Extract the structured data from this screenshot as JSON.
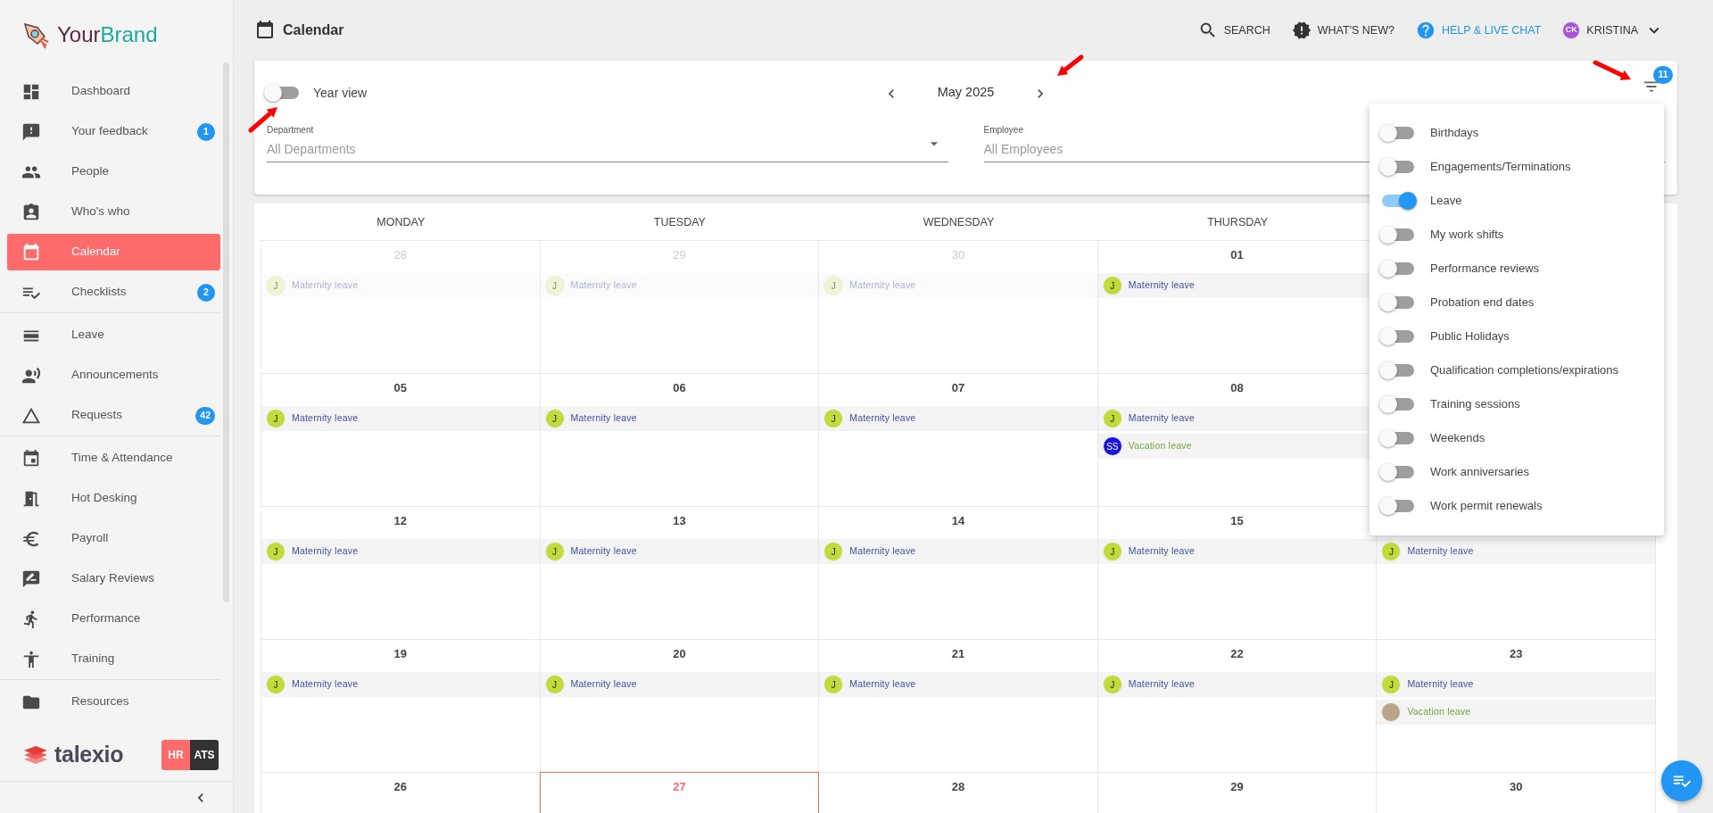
{
  "sidebar": {
    "brand_name": [
      "Your",
      "Brand"
    ],
    "groups": [
      [
        {
          "label": "Dashboard",
          "selected": false
        },
        {
          "label": "Your feedback",
          "badge": "1",
          "selected": false
        },
        {
          "label": "People",
          "selected": false
        },
        {
          "label": "Who's who",
          "selected": false
        },
        {
          "label": "Calendar",
          "selected": true
        },
        {
          "label": "Checklists",
          "badge": "2",
          "selected": false
        }
      ],
      [
        {
          "label": "Leave",
          "selected": false
        },
        {
          "label": "Announcements",
          "selected": false
        },
        {
          "label": "Requests",
          "badge": "42",
          "selected": false
        }
      ],
      [
        {
          "label": "Time & Attendance",
          "selected": false
        },
        {
          "label": "Hot Desking",
          "selected": false
        },
        {
          "label": "Payroll",
          "selected": false
        },
        {
          "label": "Salary Reviews",
          "selected": false
        },
        {
          "label": "Performance",
          "selected": false
        },
        {
          "label": "Training",
          "selected": false
        }
      ],
      [
        {
          "label": "Resources",
          "selected": false
        }
      ]
    ],
    "footer": {
      "logo_text": "talexio",
      "modes": [
        {
          "label": "HR",
          "selected": true
        },
        {
          "label": "ATS",
          "selected": false
        }
      ]
    }
  },
  "header": {
    "title": "Calendar",
    "actions": [
      {
        "label": "SEARCH",
        "kind": "search"
      },
      {
        "label": "WHAT'S NEW?",
        "kind": "news"
      },
      {
        "label": "HELP & LIVE CHAT",
        "kind": "help"
      }
    ],
    "user": {
      "initials": "CK",
      "name": "KRISTINA"
    }
  },
  "filters": {
    "year_view": {
      "label": "Year view",
      "on": false
    },
    "period": "May 2025",
    "fields": [
      {
        "label": "Department",
        "placeholder": "All Departments"
      },
      {
        "label": "Employee",
        "placeholder": "All Employees"
      }
    ],
    "filter_count": "11",
    "menu": [
      {
        "label": "Birthdays",
        "on": false
      },
      {
        "label": "Engagements/Terminations",
        "on": false
      },
      {
        "label": "Leave",
        "on": true
      },
      {
        "label": "My work shifts",
        "on": false
      },
      {
        "label": "Performance reviews",
        "on": false
      },
      {
        "label": "Probation end dates",
        "on": false
      },
      {
        "label": "Public Holidays",
        "on": false
      },
      {
        "label": "Qualification completions/expirations",
        "on": false
      },
      {
        "label": "Training sessions",
        "on": false
      },
      {
        "label": "Weekends",
        "on": false
      },
      {
        "label": "Work anniversaries",
        "on": false
      },
      {
        "label": "Work permit renewals",
        "on": false
      }
    ]
  },
  "calendar": {
    "weekdays": [
      "MONDAY",
      "TUESDAY",
      "WEDNESDAY",
      "THURSDAY"
    ],
    "weeks": [
      [
        {
          "date": "28",
          "outside": true,
          "today": false,
          "events": [
            {
              "kind": "maternity",
              "label": "Maternity leave",
              "avatar": {
                "kind": "initials",
                "text": "J",
                "color": "#eef5d2"
              }
            }
          ]
        },
        {
          "date": "29",
          "outside": true,
          "today": false,
          "events": [
            {
              "kind": "maternity",
              "label": "Maternity leave",
              "avatar": {
                "kind": "initials",
                "text": "J",
                "color": "#eef5d2"
              }
            }
          ]
        },
        {
          "date": "30",
          "outside": true,
          "today": false,
          "events": [
            {
              "kind": "maternity",
              "label": "Maternity leave",
              "avatar": {
                "kind": "initials",
                "text": "J",
                "color": "#eef5d2"
              }
            }
          ]
        },
        {
          "date": "01",
          "outside": false,
          "today": false,
          "events": [
            {
              "kind": "maternity",
              "label": "Maternity leave",
              "avatar": {
                "kind": "initials",
                "text": "J",
                "color": "#c0dc3b"
              }
            }
          ]
        }
      ],
      [
        {
          "date": "05",
          "outside": false,
          "today": false,
          "events": [
            {
              "kind": "maternity",
              "label": "Maternity leave",
              "avatar": {
                "kind": "initials",
                "text": "J",
                "color": "#c0dc3b"
              }
            }
          ]
        },
        {
          "date": "06",
          "outside": false,
          "today": false,
          "events": [
            {
              "kind": "maternity",
              "label": "Maternity leave",
              "avatar": {
                "kind": "initials",
                "text": "J",
                "color": "#c0dc3b"
              }
            }
          ]
        },
        {
          "date": "07",
          "outside": false,
          "today": false,
          "events": [
            {
              "kind": "maternity",
              "label": "Maternity leave",
              "avatar": {
                "kind": "initials",
                "text": "J",
                "color": "#c0dc3b"
              }
            }
          ]
        },
        {
          "date": "08",
          "outside": false,
          "today": false,
          "events": [
            {
              "kind": "maternity",
              "label": "Maternity leave",
              "avatar": {
                "kind": "initials",
                "text": "J",
                "color": "#c0dc3b"
              }
            },
            {
              "kind": "vacation",
              "label": "Vacation leave",
              "avatar": {
                "kind": "initials",
                "text": "SS",
                "color": "#1a10e0"
              }
            }
          ]
        }
      ],
      [
        {
          "date": "12",
          "outside": false,
          "today": false,
          "events": [
            {
              "kind": "maternity",
              "label": "Maternity leave",
              "avatar": {
                "kind": "initials",
                "text": "J",
                "color": "#c0dc3b"
              }
            }
          ]
        },
        {
          "date": "13",
          "outside": false,
          "today": false,
          "events": [
            {
              "kind": "maternity",
              "label": "Maternity leave",
              "avatar": {
                "kind": "initials",
                "text": "J",
                "color": "#c0dc3b"
              }
            }
          ]
        },
        {
          "date": "14",
          "outside": false,
          "today": false,
          "events": [
            {
              "kind": "maternity",
              "label": "Maternity leave",
              "avatar": {
                "kind": "initials",
                "text": "J",
                "color": "#c0dc3b"
              }
            }
          ]
        },
        {
          "date": "15",
          "outside": false,
          "today": false,
          "events": [
            {
              "kind": "maternity",
              "label": "Maternity leave",
              "avatar": {
                "kind": "initials",
                "text": "J",
                "color": "#c0dc3b"
              }
            }
          ]
        },
        {
          "outside": false,
          "today": false,
          "events": [
            {
              "kind": "maternity",
              "label": "Maternity leave",
              "avatar": {
                "kind": "initials",
                "text": "J",
                "color": "#c0dc3b"
              }
            }
          ]
        }
      ],
      [
        {
          "date": "19",
          "outside": false,
          "today": false,
          "events": [
            {
              "kind": "maternity",
              "label": "Maternity leave",
              "avatar": {
                "kind": "initials",
                "text": "J",
                "color": "#c0dc3b"
              }
            }
          ]
        },
        {
          "date": "20",
          "outside": false,
          "today": false,
          "events": [
            {
              "kind": "maternity",
              "label": "Maternity leave",
              "avatar": {
                "kind": "initials",
                "text": "J",
                "color": "#c0dc3b"
              }
            }
          ]
        },
        {
          "date": "21",
          "outside": false,
          "today": false,
          "events": [
            {
              "kind": "maternity",
              "label": "Maternity leave",
              "avatar": {
                "kind": "initials",
                "text": "J",
                "color": "#c0dc3b"
              }
            }
          ]
        },
        {
          "date": "22",
          "outside": false,
          "today": false,
          "events": [
            {
              "kind": "maternity",
              "label": "Maternity leave",
              "avatar": {
                "kind": "initials",
                "text": "J",
                "color": "#c0dc3b"
              }
            }
          ]
        },
        {
          "date": "23",
          "outside": false,
          "today": false,
          "events": [
            {
              "kind": "maternity",
              "label": "Maternity leave",
              "avatar": {
                "kind": "initials",
                "text": "J",
                "color": "#c0dc3b"
              }
            },
            {
              "kind": "vacation",
              "label": "Vacation leave",
              "avatar": {
                "kind": "photo"
              }
            }
          ]
        }
      ],
      [
        {
          "date": "26",
          "outside": false,
          "today": false
        },
        {
          "date": "27",
          "outside": false,
          "today": true
        },
        {
          "date": "28",
          "outside": false,
          "today": false
        },
        {
          "date": "29",
          "outside": false,
          "today": false
        },
        {
          "date": "30",
          "outside": false,
          "today": false
        }
      ]
    ]
  }
}
